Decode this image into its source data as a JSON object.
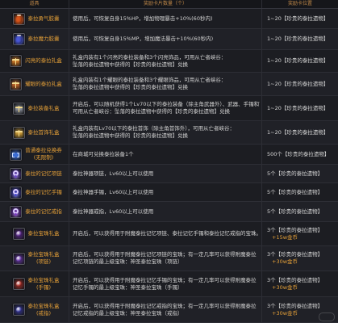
{
  "colors": {
    "background": "#1c1d22",
    "row_alt": "#202127",
    "grid_line": "#2d2e35",
    "header_text": "#c08848",
    "item_name": "#e39f38",
    "description": "#d2d2d2",
    "reward_text": "#d6d6d6",
    "reward_gold": "#e39f38"
  },
  "table": {
    "headers": {
      "item": "道具",
      "content": "奖励卡片数量（个）",
      "position": "奖励卡位置"
    },
    "rows": [
      {
        "icon": "courage-capsule-icon",
        "icon_color": "#d8561c",
        "name": [
          "泰拉勇气胶囊"
        ],
        "desc": [
          "使用后，可恢复自身15%HP，增加物理暴击+10%(60秒内)"
        ],
        "reward": [
          "1~20【珍贵的泰拉遗物】"
        ]
      },
      {
        "icon": "mana-capsule-icon",
        "icon_color": "#4a58d6",
        "name": [
          "泰拉魔力胶囊"
        ],
        "desc": [
          "使用后，可恢复自身15%MP，增加魔法暴击+10%(60秒内)"
        ],
        "reward": [
          "1~20【珍贵的泰拉遗物】"
        ]
      },
      {
        "icon": "shiny-gift-box-icon",
        "icon_color": "#c8772a",
        "name": [
          "闪亮的泰拉礼盒"
        ],
        "desc": [
          "礼盒内装有1个闪亮的泰拉装备和3个闪亮饰品，可用从亡者峡谷：",
          "坠落的泰拉遗物中获得的【珍贵的泰拉遗物】兑换"
        ],
        "reward": [
          "1~20【珍贵的泰拉遗物】"
        ]
      },
      {
        "icon": "dazzling-gift-box-icon",
        "icon_color": "#b9642c",
        "name": [
          "耀眼的泰拉礼盒"
        ],
        "desc": [
          "礼盒内装有1个耀眼的泰拉装备和3个耀眼饰品，可用从亡者峡谷：",
          "坠落的泰拉遗物中获得的【珍贵的泰拉遗物】兑换"
        ],
        "reward": [
          "1~20【珍贵的泰拉遗物】"
        ]
      },
      {
        "icon": "equipment-box-icon",
        "icon_color": "#8c919c",
        "name": [
          "泰拉装备礼盒"
        ],
        "desc": [
          "开启后，可以随机获得1个Lv70以下的泰拉装备（除主角武器外）、武器、手镯和首饰",
          "可用从亡者峡谷：坠落的泰拉遗物中获得的【珍贵的泰拉遗物】兑换"
        ],
        "reward": [
          "1~20【珍贵的泰拉遗物】"
        ]
      },
      {
        "icon": "jewelry-box-icon",
        "icon_color": "#c99a3a",
        "name": [
          "泰拉首饰礼盒"
        ],
        "desc": [
          "礼盒内装有Lv70以下的泰拉首饰（除主角首饰外），可用从亡者峡谷：",
          "坠落的泰拉遗物中获得的【珍贵的泰拉遗物】兑换"
        ],
        "reward": [
          "1~20【珍贵的泰拉遗物】"
        ]
      },
      {
        "icon": "exchange-voucher-icon",
        "icon_color": "#3b6cd2",
        "name": [
          "普通泰拉兑换券",
          "(无限制)"
        ],
        "desc": [
          "在商城可兑换泰拉装备1个"
        ],
        "reward": [
          "500个【珍贵的泰拉遗物】"
        ]
      },
      {
        "icon": "necklace-icon",
        "icon_color": "#6c48c8",
        "name": [
          "泰拉的记忆项链"
        ],
        "desc": [
          "泰拉神器项链，Lv60以上可以使用"
        ],
        "reward": [
          "5个【珍贵的泰拉遗物】"
        ]
      },
      {
        "icon": "bracelet-icon",
        "icon_color": "#4a4ad0",
        "name": [
          "泰拉的记忆手镯"
        ],
        "desc": [
          "泰拉神器手镯，Lv60以上可以使用"
        ],
        "reward": [
          "5个【珍贵的泰拉遗物】"
        ]
      },
      {
        "icon": "ring-icon",
        "icon_color": "#7a3ac0",
        "name": [
          "泰拉的记忆戒指"
        ],
        "desc": [
          "泰拉神器戒指，Lv60以上可以使用"
        ],
        "reward": [
          "5个【珍贵的泰拉遗物】"
        ]
      },
      {
        "icon": "orb-gift-box-icon",
        "icon_color": "#5a2a8a",
        "name": [
          "泰拉宝珠礼盒"
        ],
        "desc": [
          "开启后，可以获得用于附魔泰拉记忆项链、泰拉记忆手镯和泰拉记忆戒指的宝珠。"
        ],
        "reward": [
          "3个【珍贵的泰拉遗物】",
          "+15w金币"
        ]
      },
      {
        "icon": "necklace-orb-box-icon",
        "icon_color": "#6a3aa8",
        "name": [
          "泰拉宝珠礼盒",
          "(项链)"
        ],
        "desc": [
          "开启后，可以获得用于附魔泰拉记忆项链的宝珠；有一定几率可以获得附魔泰拉",
          "记忆项链的最上级宝珠：神圣泰拉宝珠（项链）"
        ],
        "reward": [
          "3个【珍贵的泰拉遗物】",
          "+30w金币"
        ]
      },
      {
        "icon": "bracelet-orb-box-icon",
        "icon_color": "#a8302a",
        "name": [
          "泰拉宝珠礼盒",
          "(手镯)"
        ],
        "desc": [
          "开启后，可以获得用于附魔泰拉记忆手镯的宝珠；有一定几率可以获得附魔泰拉",
          "记忆手镯的最上级宝珠：神圣泰拉宝珠（手镯）"
        ],
        "reward": [
          "3个【珍贵的泰拉遗物】",
          "+30w金币"
        ]
      },
      {
        "icon": "ring-orb-box-icon",
        "icon_color": "#3a3a9a",
        "name": [
          "泰拉宝珠礼盒",
          "(戒指)"
        ],
        "desc": [
          "开启后，可以获得用于附魔泰拉记忆戒指的宝珠；有一定几率可以获得附魔泰拉",
          "记忆戒指的最上级宝珠：神圣泰拉宝珠（戒指）"
        ],
        "reward": [
          "3个【珍贵的泰拉遗物】",
          "+30w金币"
        ]
      }
    ]
  }
}
